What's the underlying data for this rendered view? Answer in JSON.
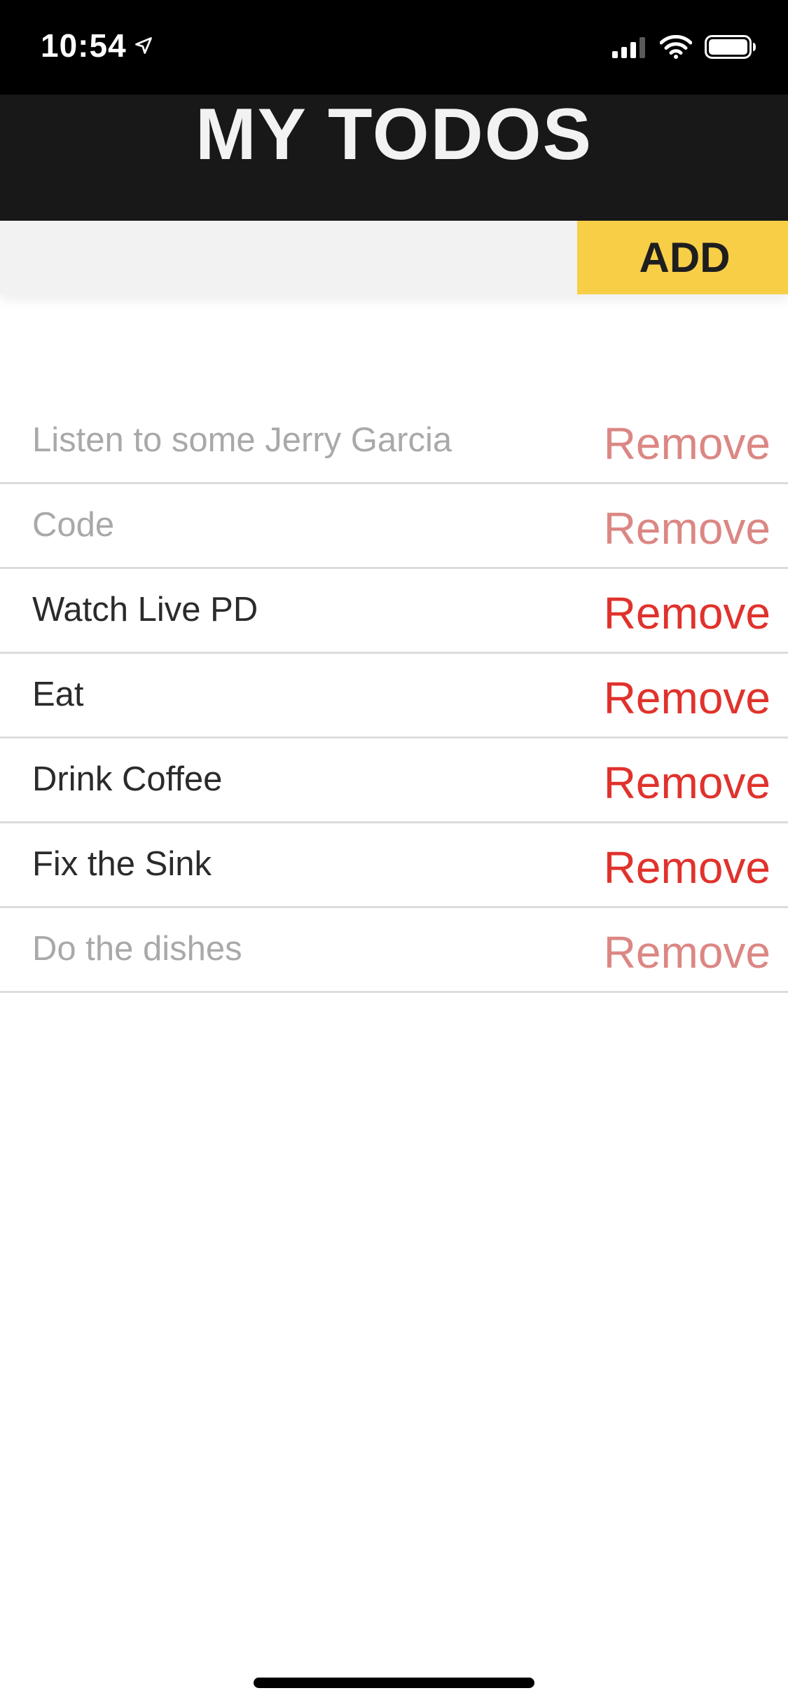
{
  "status_bar": {
    "time": "10:54",
    "icons": [
      "location-arrow-icon",
      "signal-icon",
      "wifi-icon",
      "battery-icon"
    ]
  },
  "header": {
    "title": "MY TODOS"
  },
  "add_bar": {
    "input_value": "",
    "input_placeholder": "",
    "add_label": "ADD"
  },
  "todos": [
    {
      "text": "Listen to some Jerry Garcia",
      "remove_label": "Remove",
      "done": true
    },
    {
      "text": "Code",
      "remove_label": "Remove",
      "done": true
    },
    {
      "text": "Watch Live PD",
      "remove_label": "Remove",
      "done": false
    },
    {
      "text": "Eat",
      "remove_label": "Remove",
      "done": false
    },
    {
      "text": "Drink Coffee",
      "remove_label": "Remove",
      "done": false
    },
    {
      "text": "Fix the Sink",
      "remove_label": "Remove",
      "done": false
    },
    {
      "text": "Do the dishes",
      "remove_label": "Remove",
      "done": true
    }
  ],
  "colors": {
    "header_bg": "#181818",
    "add_button_bg": "#f7ce46",
    "remove_active": "#e0322c",
    "remove_done": "#db8784",
    "text_active": "#2b2b2b",
    "text_done": "#a9a9a9"
  }
}
